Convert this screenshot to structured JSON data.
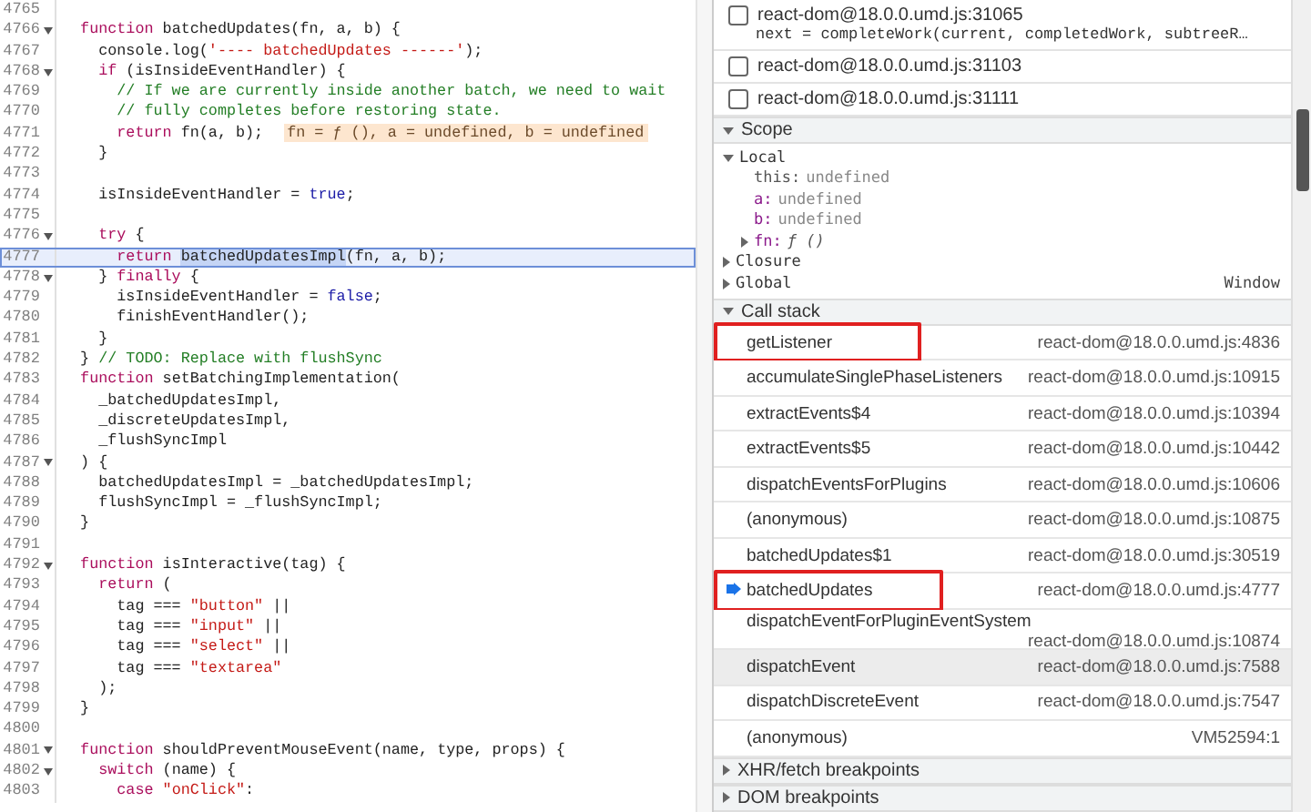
{
  "editor": {
    "lines": [
      {
        "number": "4765",
        "fold": false
      },
      {
        "number": "4766",
        "fold": true,
        "tokens": [
          {
            "kind": "k",
            "text": "  function"
          },
          {
            "kind": "p",
            "text": " batchedUpdates(fn, a, b) {"
          }
        ]
      },
      {
        "number": "4767",
        "fold": false,
        "tokens": [
          {
            "kind": "p",
            "text": "    console.log("
          },
          {
            "kind": "s",
            "text": "'---- batchedUpdates ------'"
          },
          {
            "kind": "p",
            "text": ");"
          }
        ]
      },
      {
        "number": "4768",
        "fold": true,
        "tokens": [
          {
            "kind": "k",
            "text": "    if"
          },
          {
            "kind": "p",
            "text": " (isInsideEventHandler) {"
          }
        ]
      },
      {
        "number": "4769",
        "fold": false,
        "tokens": [
          {
            "kind": "c",
            "text": "      // If we are currently inside another batch, we need to wait"
          }
        ]
      },
      {
        "number": "4770",
        "fold": false,
        "tokens": [
          {
            "kind": "c",
            "text": "      // fully completes before restoring state."
          }
        ]
      },
      {
        "number": "4771",
        "fold": false,
        "tokens": [
          {
            "kind": "k",
            "text": "      return"
          },
          {
            "kind": "p",
            "text": " fn(a, b); "
          },
          {
            "kind": "hint",
            "text": "fn = ƒ (), a = undefined, b = undefined"
          }
        ]
      },
      {
        "number": "4772",
        "fold": false,
        "tokens": [
          {
            "kind": "p",
            "text": "    }"
          }
        ]
      },
      {
        "number": "4773",
        "fold": false
      },
      {
        "number": "4774",
        "fold": false,
        "tokens": [
          {
            "kind": "p",
            "text": "    isInsideEventHandler = "
          },
          {
            "kind": "v",
            "text": "true"
          },
          {
            "kind": "p",
            "text": ";"
          }
        ]
      },
      {
        "number": "4775",
        "fold": false
      },
      {
        "number": "4776",
        "fold": true,
        "tokens": [
          {
            "kind": "k",
            "text": "    try"
          },
          {
            "kind": "p",
            "text": " {"
          }
        ]
      },
      {
        "number": "4777",
        "fold": false,
        "current": true,
        "tokens": [
          {
            "kind": "k",
            "text": "      return "
          },
          {
            "kind": "sel",
            "text": "batchedUpdatesImpl"
          },
          {
            "kind": "p",
            "text": "(fn, a, b);"
          }
        ]
      },
      {
        "number": "4778",
        "fold": true,
        "tokens": [
          {
            "kind": "p",
            "text": "    } "
          },
          {
            "kind": "k",
            "text": "finally"
          },
          {
            "kind": "p",
            "text": " {"
          }
        ]
      },
      {
        "number": "4779",
        "fold": false,
        "tokens": [
          {
            "kind": "p",
            "text": "      isInsideEventHandler = "
          },
          {
            "kind": "v",
            "text": "false"
          },
          {
            "kind": "p",
            "text": ";"
          }
        ]
      },
      {
        "number": "4780",
        "fold": false,
        "tokens": [
          {
            "kind": "p",
            "text": "      finishEventHandler();"
          }
        ]
      },
      {
        "number": "4781",
        "fold": false,
        "tokens": [
          {
            "kind": "p",
            "text": "    }"
          }
        ]
      },
      {
        "number": "4782",
        "fold": false,
        "tokens": [
          {
            "kind": "p",
            "text": "  } "
          },
          {
            "kind": "c",
            "text": "// TODO: Replace with flushSync"
          }
        ]
      },
      {
        "number": "4783",
        "fold": false,
        "tokens": [
          {
            "kind": "k",
            "text": "  function"
          },
          {
            "kind": "p",
            "text": " setBatchingImplementation("
          }
        ]
      },
      {
        "number": "4784",
        "fold": false,
        "tokens": [
          {
            "kind": "p",
            "text": "    _batchedUpdatesImpl,"
          }
        ]
      },
      {
        "number": "4785",
        "fold": false,
        "tokens": [
          {
            "kind": "p",
            "text": "    _discreteUpdatesImpl,"
          }
        ]
      },
      {
        "number": "4786",
        "fold": false,
        "tokens": [
          {
            "kind": "p",
            "text": "    _flushSyncImpl"
          }
        ]
      },
      {
        "number": "4787",
        "fold": true,
        "tokens": [
          {
            "kind": "p",
            "text": "  ) {"
          }
        ]
      },
      {
        "number": "4788",
        "fold": false,
        "tokens": [
          {
            "kind": "p",
            "text": "    batchedUpdatesImpl = _batchedUpdatesImpl;"
          }
        ]
      },
      {
        "number": "4789",
        "fold": false,
        "tokens": [
          {
            "kind": "p",
            "text": "    flushSyncImpl = _flushSyncImpl;"
          }
        ]
      },
      {
        "number": "4790",
        "fold": false,
        "tokens": [
          {
            "kind": "p",
            "text": "  }"
          }
        ]
      },
      {
        "number": "4791",
        "fold": false
      },
      {
        "number": "4792",
        "fold": true,
        "tokens": [
          {
            "kind": "k",
            "text": "  function"
          },
          {
            "kind": "p",
            "text": " isInteractive(tag) {"
          }
        ]
      },
      {
        "number": "4793",
        "fold": false,
        "tokens": [
          {
            "kind": "k",
            "text": "    return"
          },
          {
            "kind": "p",
            "text": " ("
          }
        ]
      },
      {
        "number": "4794",
        "fold": false,
        "tokens": [
          {
            "kind": "p",
            "text": "      tag === "
          },
          {
            "kind": "s",
            "text": "\"button\""
          },
          {
            "kind": "p",
            "text": " ||"
          }
        ]
      },
      {
        "number": "4795",
        "fold": false,
        "tokens": [
          {
            "kind": "p",
            "text": "      tag === "
          },
          {
            "kind": "s",
            "text": "\"input\""
          },
          {
            "kind": "p",
            "text": " ||"
          }
        ]
      },
      {
        "number": "4796",
        "fold": false,
        "tokens": [
          {
            "kind": "p",
            "text": "      tag === "
          },
          {
            "kind": "s",
            "text": "\"select\""
          },
          {
            "kind": "p",
            "text": " ||"
          }
        ]
      },
      {
        "number": "4797",
        "fold": false,
        "tokens": [
          {
            "kind": "p",
            "text": "      tag === "
          },
          {
            "kind": "s",
            "text": "\"textarea\""
          }
        ]
      },
      {
        "number": "4798",
        "fold": false,
        "tokens": [
          {
            "kind": "p",
            "text": "    );"
          }
        ]
      },
      {
        "number": "4799",
        "fold": false,
        "tokens": [
          {
            "kind": "p",
            "text": "  }"
          }
        ]
      },
      {
        "number": "4800",
        "fold": false
      },
      {
        "number": "4801",
        "fold": true,
        "tokens": [
          {
            "kind": "k",
            "text": "  function"
          },
          {
            "kind": "p",
            "text": " shouldPreventMouseEvent(name, type, props) {"
          }
        ]
      },
      {
        "number": "4802",
        "fold": true,
        "tokens": [
          {
            "kind": "k",
            "text": "    switch"
          },
          {
            "kind": "p",
            "text": " (name) {"
          }
        ]
      },
      {
        "number": "4803",
        "fold": false,
        "tokens": [
          {
            "kind": "k",
            "text": "      case "
          },
          {
            "kind": "s",
            "text": "\"onClick\""
          },
          {
            "kind": "p",
            "text": ":"
          }
        ]
      }
    ]
  },
  "breakpoints": [
    {
      "label": "react-dom@18.0.0.umd.js:31065",
      "snippet": "next = completeWork(current, completedWork, subtreeR…",
      "checked": false
    },
    {
      "label": "react-dom@18.0.0.umd.js:31103",
      "checked": false
    },
    {
      "label": "react-dom@18.0.0.umd.js:31111",
      "checked": false
    }
  ],
  "scope": {
    "title": "Scope",
    "expanded": true,
    "children": [
      {
        "label": "Local",
        "expanded": true,
        "children": [
          {
            "name": "this:",
            "value": "undefined",
            "kind": "plain"
          },
          {
            "name": "a:",
            "value": "undefined",
            "kind": "arg"
          },
          {
            "name": "b:",
            "value": "undefined",
            "kind": "arg"
          },
          {
            "name": "fn:",
            "value": "ƒ ()",
            "kind": "arg",
            "expanded": false
          }
        ]
      },
      {
        "label": "Closure",
        "expanded": false
      },
      {
        "label": "Global",
        "expanded": false,
        "value": "Window"
      }
    ]
  },
  "call_stack": {
    "title": "Call stack",
    "expanded": true,
    "frames": [
      {
        "name": "getListener",
        "location": "react-dom@18.0.0.umd.js:4836",
        "current": false,
        "hovered": false,
        "annotated": true
      },
      {
        "name": "accumulateSinglePhaseListeners",
        "location": "react-dom@18.0.0.umd.js:10915",
        "current": false,
        "hovered": false,
        "annotated": false
      },
      {
        "name": "extractEvents$4",
        "location": "react-dom@18.0.0.umd.js:10394",
        "current": false,
        "hovered": false,
        "annotated": false
      },
      {
        "name": "extractEvents$5",
        "location": "react-dom@18.0.0.umd.js:10442",
        "current": false,
        "hovered": false,
        "annotated": false
      },
      {
        "name": "dispatchEventsForPlugins",
        "location": "react-dom@18.0.0.umd.js:10606",
        "current": false,
        "hovered": false,
        "annotated": false
      },
      {
        "name": "(anonymous)",
        "location": "react-dom@18.0.0.umd.js:10875",
        "current": false,
        "hovered": false,
        "annotated": false
      },
      {
        "name": "batchedUpdates$1",
        "location": "react-dom@18.0.0.umd.js:30519",
        "current": false,
        "hovered": false,
        "annotated": false
      },
      {
        "name": "batchedUpdates",
        "location": "react-dom@18.0.0.umd.js:4777",
        "current": true,
        "hovered": false,
        "annotated": true
      },
      {
        "name": "dispatchEventForPluginEventSystem",
        "location": "react-dom@18.0.0.umd.js:10874",
        "current": false,
        "hovered": false,
        "annotated": false
      },
      {
        "name": "dispatchEvent",
        "location": "react-dom@18.0.0.umd.js:7588",
        "current": false,
        "hovered": true,
        "annotated": false
      },
      {
        "name": "dispatchDiscreteEvent",
        "location": "react-dom@18.0.0.umd.js:7547",
        "current": false,
        "hovered": false,
        "annotated": false
      },
      {
        "name": "(anonymous)",
        "location": "VM52594:1",
        "current": false,
        "hovered": false,
        "annotated": false
      }
    ]
  },
  "sections": [
    {
      "title": "XHR/fetch breakpoints",
      "expanded": false
    },
    {
      "title": "DOM breakpoints",
      "expanded": false
    }
  ]
}
